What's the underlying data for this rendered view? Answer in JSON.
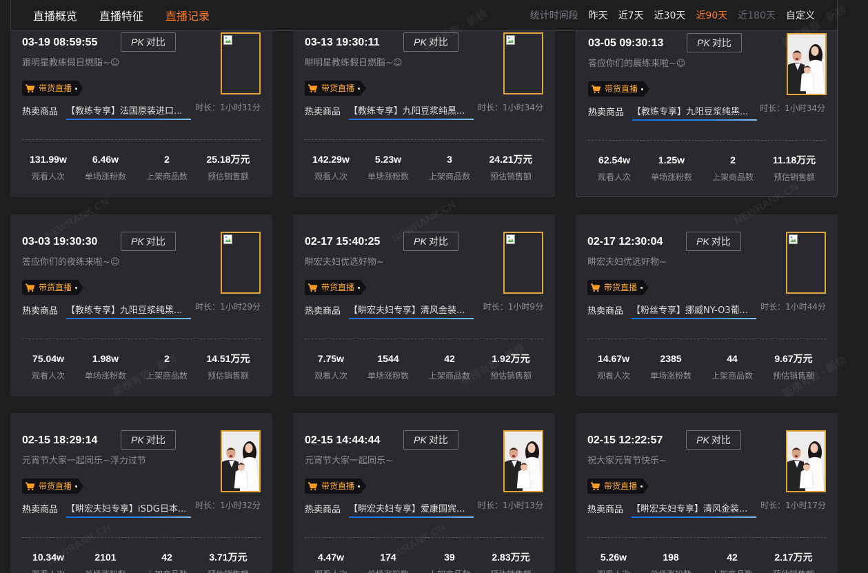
{
  "nav": {
    "tabs": [
      "直播概览",
      "直播特征",
      "直播记录"
    ],
    "period_label": "统计时间段",
    "periods": [
      "昨天",
      "近7天",
      "近30天",
      "近90天",
      "近180天",
      "自定义"
    ]
  },
  "labels": {
    "pk_prefix": "PK",
    "pk_label": "对比",
    "badge": "带货直播",
    "hot_products": "热卖商品",
    "stats": [
      "观看人次",
      "单场涨粉数",
      "上架商品数",
      "预估销售额"
    ]
  },
  "records": [
    {
      "datetime": "03-19 08:59:55",
      "title": "跟明星教练假日燃脂~☺",
      "product": "【教练专享】法国原装进口...",
      "duration": "时长：1小时31分",
      "stats": [
        "131.99w",
        "6.46w",
        "2",
        "25.18万元"
      ],
      "thumbnail": "broken-image-icon"
    },
    {
      "datetime": "03-13 19:30:11",
      "title": "畊明星教练假日燃脂~☺",
      "product": "【教练专享】九阳豆浆纯黑...",
      "duration": "时长：1小时34分",
      "stats": [
        "142.29w",
        "5.23w",
        "3",
        "24.21万元"
      ],
      "thumbnail": "broken-image-icon"
    },
    {
      "datetime": "03-05 09:30:13",
      "title": "答应你们的晨练来啦~☺",
      "product": "【教练专享】九阳豆浆纯黑...",
      "duration": "时长：1小时34分",
      "stats": [
        "62.54w",
        "1.25w",
        "2",
        "11.18万元"
      ],
      "thumbnail": "cover-photo"
    },
    {
      "datetime": "03-03 19:30:30",
      "title": "答应你们的夜练来啦~☺",
      "product": "【教练专享】九阳豆浆纯黑...",
      "duration": "时长：1小时29分",
      "stats": [
        "75.04w",
        "1.98w",
        "2",
        "14.51万元"
      ],
      "thumbnail": "broken-image-icon"
    },
    {
      "datetime": "02-17 15:40:25",
      "title": "畊宏夫妇优选好物~",
      "product": "【畊宏夫妇专享】清风金装...",
      "duration": "时长：1小时9分",
      "stats": [
        "7.75w",
        "1544",
        "42",
        "1.92万元"
      ],
      "thumbnail": "broken-image-icon"
    },
    {
      "datetime": "02-17 12:30:04",
      "title": "畊宏夫妇优选好物~",
      "product": "【粉丝专享】挪威NY-O3葡...",
      "duration": "时长：1小时44分",
      "stats": [
        "14.67w",
        "2385",
        "44",
        "9.67万元"
      ],
      "thumbnail": "broken-image-icon"
    },
    {
      "datetime": "02-15 18:29:14",
      "title": "元宵节大家一起同乐~浮力过节",
      "product": "【畊宏夫妇专享】iSDG日本...",
      "duration": "时长：1小时32分",
      "stats": [
        "10.34w",
        "2101",
        "42",
        "3.71万元"
      ],
      "thumbnail": "cover-photo"
    },
    {
      "datetime": "02-15 14:44:44",
      "title": "元宵节大家一起同乐~",
      "product": "【畊宏夫妇专享】爱康国宾...",
      "duration": "时长：1小时13分",
      "stats": [
        "4.47w",
        "174",
        "39",
        "2.83万元"
      ],
      "thumbnail": "cover-photo"
    },
    {
      "datetime": "02-15 12:22:57",
      "title": "祝大家元宵节快乐~",
      "product": "【畊宏夫妇专享】清风金装...",
      "duration": "时长：1小时17分",
      "stats": [
        "5.26w",
        "198",
        "42",
        "2.17万元"
      ],
      "thumbnail": "cover-photo"
    }
  ],
  "watermark": {
    "en": "NEWRANK.CN",
    "cn": "新榜有数 · 新榜"
  },
  "colors": {
    "accent": "#ff7a1a",
    "thumbnail_border": "#e0a63c",
    "badge_text": "#ffab2e",
    "link_underline": "#2f86f0"
  }
}
